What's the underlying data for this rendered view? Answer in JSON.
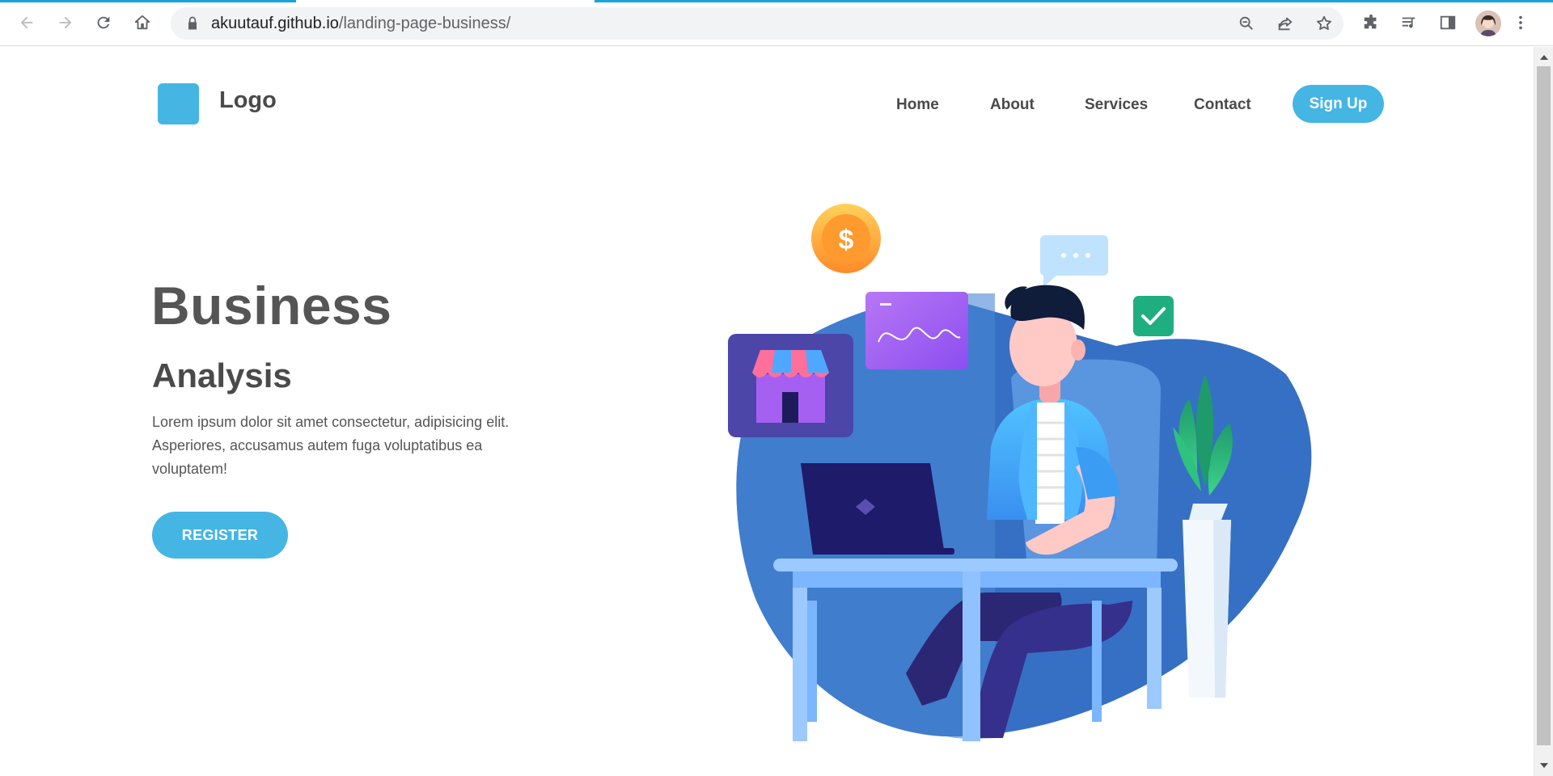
{
  "browser": {
    "url_host": "akuutauf.github.io",
    "url_path": "/landing-page-business/",
    "icons": [
      "back-icon",
      "forward-icon",
      "reload-icon",
      "home-icon",
      "lock-icon",
      "zoom-out-icon",
      "share-icon",
      "star-icon",
      "extensions-icon",
      "media-icon",
      "side-panel-icon",
      "avatar",
      "menu-icon"
    ],
    "accent_color": "#1aa3d9"
  },
  "header": {
    "logo_label": "Logo",
    "nav": [
      {
        "label": "Home"
      },
      {
        "label": "About"
      },
      {
        "label": "Services"
      },
      {
        "label": "Contact"
      }
    ],
    "signup_label": "Sign Up"
  },
  "hero": {
    "title": "Business",
    "subtitle": "Analysis",
    "text": "Lorem ipsum dolor sit amet consectetur, adipisicing elit. Asperiores, accusamus autem fuga voluptatibus ea voluptatem!",
    "cta_label": "REGISTER",
    "coin_symbol": "$"
  },
  "colors": {
    "brand": "#45b5e3",
    "heading": "#555555",
    "blob": "#3670c4"
  }
}
